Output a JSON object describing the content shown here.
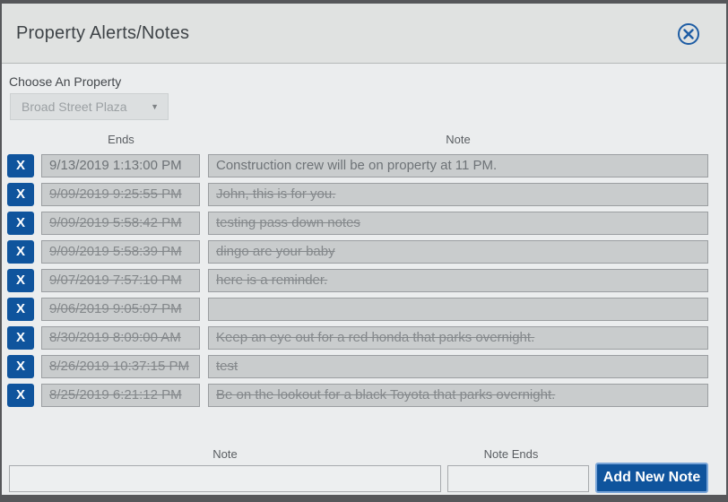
{
  "dialog": {
    "title": "Property Alerts/Notes",
    "close_icon": "circled-x-icon"
  },
  "property_selector": {
    "label": "Choose An Property",
    "selected_option": "Broad Street Plaza",
    "caret_icon": "▼"
  },
  "notes_table": {
    "columns": {
      "ends": "Ends",
      "note": "Note"
    },
    "delete_label": "X",
    "rows": [
      {
        "ends": "9/13/2019 1:13:00 PM",
        "note": "Construction crew will be on property at 11 PM.",
        "expired": false
      },
      {
        "ends": "9/09/2019 9:25:55 PM",
        "note": "John, this is for you.",
        "expired": true
      },
      {
        "ends": "9/09/2019 5:58:42 PM",
        "note": "testing pass down notes",
        "expired": true
      },
      {
        "ends": "9/09/2019 5:58:39 PM",
        "note": "dingo are your baby",
        "expired": true
      },
      {
        "ends": "9/07/2019 7:57:10 PM",
        "note": "here is a reminder.",
        "expired": true
      },
      {
        "ends": "9/06/2019 9:05:07 PM",
        "note": "",
        "expired": true
      },
      {
        "ends": "8/30/2019 8:09:00 AM",
        "note": "Keep an eye out for a red honda that parks overnight.",
        "expired": true
      },
      {
        "ends": "8/26/2019 10:37:15 PM",
        "note": "test",
        "expired": true
      },
      {
        "ends": "8/25/2019 6:21:12 PM",
        "note": "Be on the lookout for a black Toyota that parks overnight.",
        "expired": true
      }
    ]
  },
  "new_note_form": {
    "note_label": "Note",
    "note_value": "",
    "note_ends_label": "Note Ends",
    "note_ends_value": "",
    "add_button_label": "Add New Note"
  },
  "colors": {
    "accent_blue": "#0f549d",
    "button_focus_ring": "#79a5d8",
    "titlebar_bg": "#e0e2e1",
    "body_bg": "#ebedee",
    "field_bg": "#c9cccd",
    "field_border": "#9b9ea1",
    "window_border": "#56575a"
  }
}
